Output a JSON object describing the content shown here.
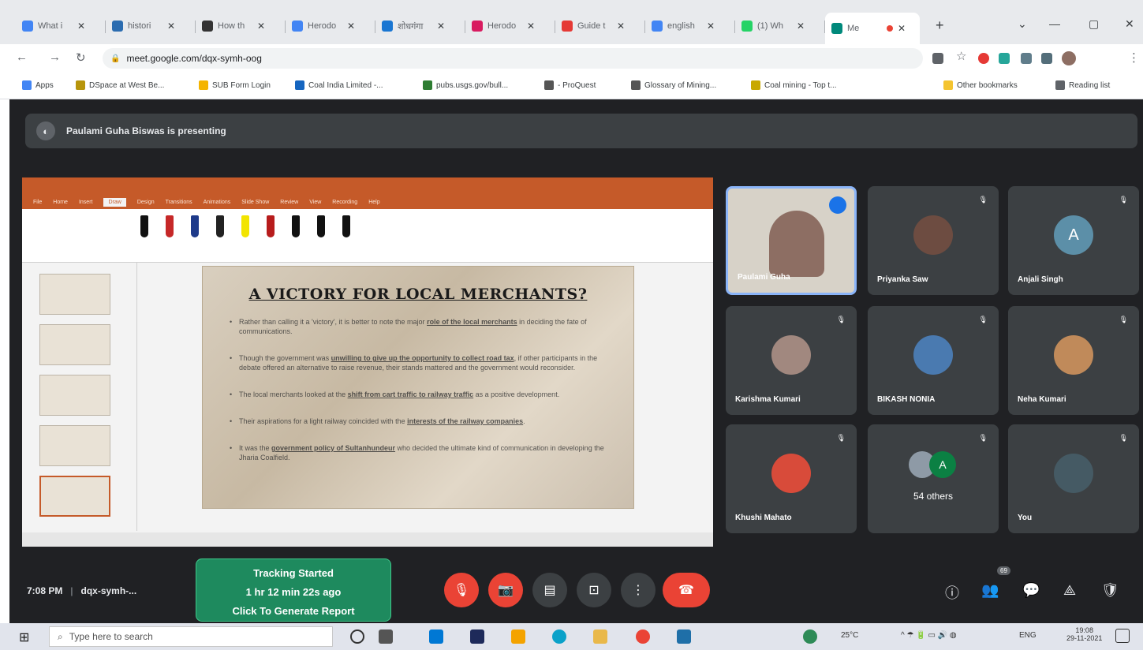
{
  "browser": {
    "tabs": [
      {
        "title": "What i",
        "color": "#4285f4"
      },
      {
        "title": "histori",
        "color": "#2b6cb0"
      },
      {
        "title": "How th",
        "color": "#333333"
      },
      {
        "title": "Herodo",
        "color": "#4285f4"
      },
      {
        "title": "शोधगंगा",
        "color": "#1976d2"
      },
      {
        "title": "Herodo",
        "color": "#d81b60"
      },
      {
        "title": "Guide t",
        "color": "#e53935"
      },
      {
        "title": "english",
        "color": "#4285f4"
      },
      {
        "title": "(1) Wh",
        "color": "#25d366"
      },
      {
        "title": "Me",
        "color": "#00897b",
        "active": true
      }
    ],
    "new_tab_symbol": "+",
    "window_controls": [
      "⌄",
      "—",
      "▢",
      "✕"
    ],
    "url": "meet.google.com/dqx-symh-oog",
    "bookmarks": [
      {
        "label": "Apps",
        "color": "#4285f4"
      },
      {
        "label": "DSpace at West Be...",
        "color": "#b7950b"
      },
      {
        "label": "SUB Form Login",
        "color": "#f4b400"
      },
      {
        "label": "Coal India Limited -...",
        "color": "#1565c0"
      },
      {
        "label": "pubs.usgs.gov/bull...",
        "color": "#2e7d32"
      },
      {
        "label": "- ProQuest",
        "color": "#555555"
      },
      {
        "label": "Glossary of Mining...",
        "color": "#555555"
      },
      {
        "label": "Coal mining - Top t...",
        "color": "#c8a800"
      },
      {
        "label": "Other bookmarks",
        "color": "#f4c430"
      },
      {
        "label": "Reading list",
        "color": "#5f6368"
      }
    ]
  },
  "meet": {
    "presenting_banner": "Paulami Guha Biswas is presenting",
    "slide": {
      "title": "A VICTORY FOR LOCAL MERCHANTS?",
      "bullets": [
        {
          "text": "Rather than calling it a 'victory', it is better to note the major ",
          "bold": "role of the local merchants",
          "tail": " in deciding the fate of communications."
        },
        {
          "text": "Though the government was ",
          "bold": "unwilling to give up the opportunity to collect road tax",
          "tail": ", if other participants in the debate offered an alternative to raise revenue, their stands mattered and the government would reconsider."
        },
        {
          "text": "The local merchants looked at the ",
          "bold": "shift from cart traffic to railway traffic",
          "tail": " as a positive development."
        },
        {
          "text": "Their aspirations for a light railway coincided with the ",
          "bold": "interests of the railway companies",
          "tail": "."
        },
        {
          "text": "It was the ",
          "bold": "government policy of Sultanhundeur",
          "tail": " who decided the ultimate kind of communication in developing the Jharia Coalfield."
        }
      ]
    },
    "participants": [
      {
        "name": "Paulami Guha",
        "speaking": true,
        "avatar_color": "#8d6e63"
      },
      {
        "name": "Priyanka Saw",
        "avatar_color": "#6d4c41"
      },
      {
        "name": "Anjali Singh",
        "letter": "A",
        "avatar_color": "#5c8fa8"
      },
      {
        "name": "Karishma Kumari",
        "avatar_color": "#a1887f"
      },
      {
        "name": "BIKASH NONIA",
        "avatar_color": "#4a7ab0"
      },
      {
        "name": "Neha Kumari",
        "avatar_color": "#c08a5a"
      },
      {
        "name": "Khushi Mahato",
        "avatar_color": "#d84b3a"
      },
      {
        "name": "54 others",
        "letter": "A",
        "avatar_color": "#0b8043",
        "is_others": true
      },
      {
        "name": "You",
        "avatar_color": "#455a64"
      }
    ],
    "time": "7:08 PM",
    "meeting_code": "dqx-symh-...",
    "tracking": {
      "line1": "Tracking Started",
      "line2": "1 hr 12 min 22s ago",
      "line3": "Click To Generate Report"
    },
    "controls": {
      "mic_icon": "🎙",
      "cam_icon": "📷",
      "captions_icon": "▤",
      "present_icon": "⊡",
      "more_icon": "⋮",
      "end_icon": "☎"
    },
    "right_controls": {
      "info_icon": "ⓘ",
      "people_icon": "👥",
      "people_count": "69",
      "chat_icon": "💬",
      "activities_icon": "⟁",
      "security_icon": "🛡"
    }
  },
  "taskbar": {
    "search_placeholder": "Type here to search",
    "weather": "25°C",
    "lang": "ENG",
    "clock_time": "19:08",
    "clock_date": "29-11-2021"
  }
}
